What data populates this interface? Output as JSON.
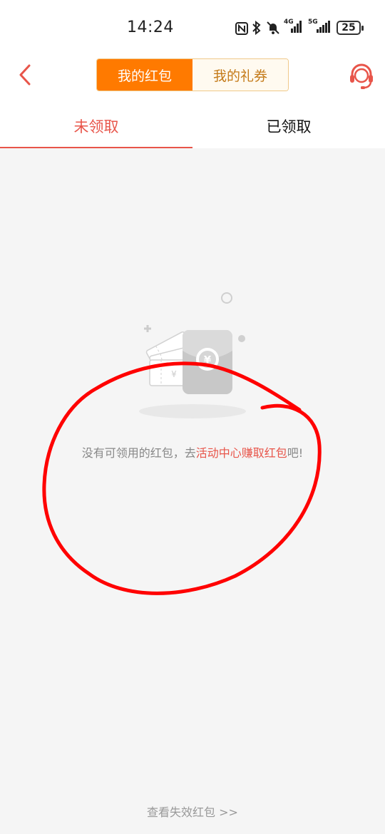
{
  "status_bar": {
    "time": "14:24",
    "network_1": "4G",
    "network_2": "5G",
    "battery": "25",
    "icons": [
      "nfc-icon",
      "bluetooth-icon",
      "mute-icon",
      "signal-4g-icon",
      "signal-5g-icon",
      "battery-icon"
    ]
  },
  "header": {
    "segments": [
      {
        "label": "我的红包",
        "active": true
      },
      {
        "label": "我的礼券",
        "active": false
      }
    ],
    "back_icon": "chevron-left-icon",
    "service_icon": "headset-icon",
    "accent_color": "#ff7a00"
  },
  "tabs": [
    {
      "label": "未领取",
      "active": true
    },
    {
      "label": "已领取",
      "active": false
    }
  ],
  "empty_state": {
    "message_prefix": "没有可领用的红包，去",
    "message_link": "活动中心赚取红包",
    "message_suffix": "吧!",
    "illustration": "red-envelope-illustration"
  },
  "footer": {
    "expired_link": "查看失效红包 >>"
  },
  "colors": {
    "highlight": "#e8554a",
    "annotation": "#ff0000"
  }
}
